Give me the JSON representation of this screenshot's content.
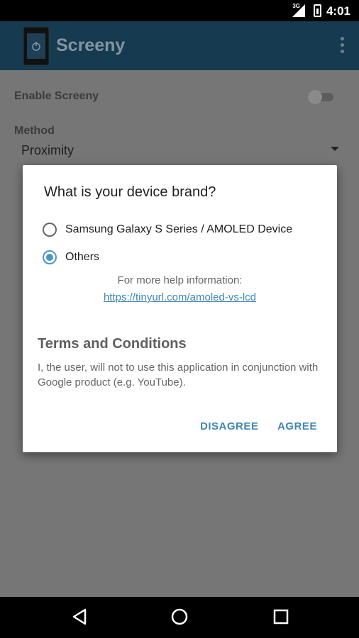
{
  "status_bar": {
    "time": "4:01",
    "network": "3G"
  },
  "app_bar": {
    "title": "Screeny"
  },
  "settings": {
    "enable_label": "Enable Screeny",
    "method_label": "Method",
    "method_value": "Proximity"
  },
  "dialog": {
    "title": "What is your device brand?",
    "options": [
      {
        "label": "Samsung Galaxy S Series / AMOLED Device",
        "checked": false
      },
      {
        "label": "Others",
        "checked": true
      }
    ],
    "help_text": "For more help information:",
    "help_link": "https://tinyurl.com/amoled-vs-lcd",
    "terms_title": "Terms and Conditions",
    "terms_body": "I, the user, will not to use this application in conjunction with Google product (e.g. YouTube).",
    "disagree_label": "DISAGREE",
    "agree_label": "AGREE"
  },
  "colors": {
    "accent": "#4b97c4",
    "appbar": "#163a4f"
  }
}
